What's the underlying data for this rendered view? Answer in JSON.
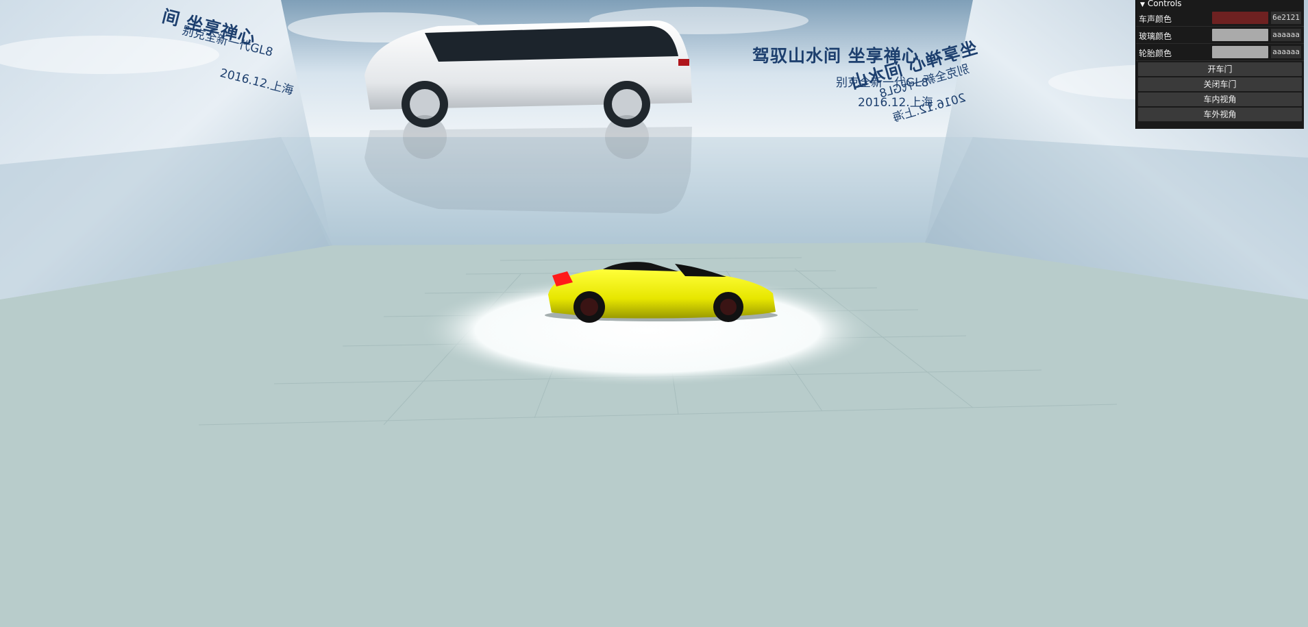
{
  "billboard": {
    "headline": "驾驭山水间  坐享禅心",
    "subline": "别克全新一代GL8",
    "date": "2016.12.上海",
    "left_headline_fragment": "间  坐享禅心",
    "right_headline_fragment": "坐享禅心  间水山"
  },
  "controls": {
    "title": "Controls",
    "color_rows": [
      {
        "label": "车声颜色",
        "hex": "6e2121",
        "color": "#6e2121"
      },
      {
        "label": "玻璃颜色",
        "hex": "aaaaaa",
        "color": "#aaaaaa"
      },
      {
        "label": "轮胎颜色",
        "hex": "aaaaaa",
        "color": "#aaaaaa"
      }
    ],
    "buttons": [
      {
        "label": "开车门"
      },
      {
        "label": "关闭车门"
      },
      {
        "label": "车内视角"
      },
      {
        "label": "车外视角"
      }
    ]
  },
  "colors": {
    "floor": "#b8cccb",
    "text_blue": "#1d3f6e",
    "car_body": "#f0f000",
    "panel_bg": "#1a1a1a"
  },
  "icons": {
    "collapse": "chevron-down-icon"
  }
}
